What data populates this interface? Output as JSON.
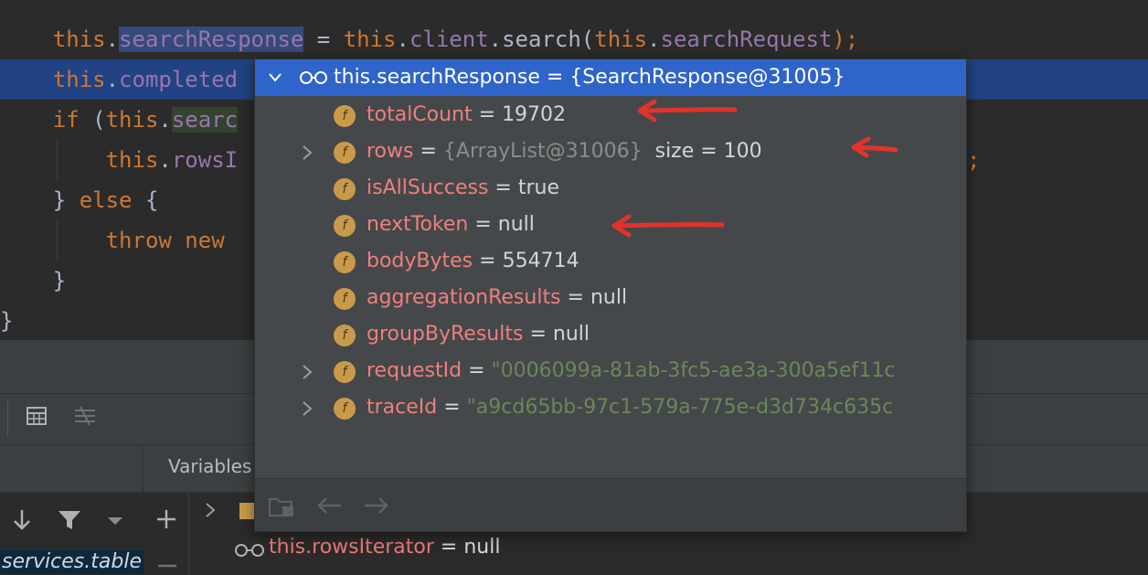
{
  "editor": {
    "line1": {
      "kw": "this",
      "dot": ".",
      "field": "searchResponse",
      "rest1": " = ",
      "kw2": "this",
      "dot2": ".",
      "field2": "client",
      "rest2": ".search(",
      "kw3": "this",
      "dot3": ".",
      "field3": "searchRequest",
      "rest3": ");"
    },
    "line2": {
      "kw": "this",
      "dot": ".",
      "field": "completed"
    },
    "line3": {
      "kw": "if",
      "rest": " (",
      "kw2": "this",
      "dot": ".",
      "field": "searc"
    },
    "line4": {
      "kw": "this",
      "dot": ".",
      "field": "rowsI",
      "tail": ";"
    },
    "line5": {
      "brace": "} ",
      "kw": "else",
      "rest": " {"
    },
    "line6": {
      "kw": "throw",
      "rest": " ",
      "kw2": "new"
    },
    "line7": {
      "brace": "}"
    },
    "line8": {
      "brace": "}"
    }
  },
  "popup": {
    "title": "this.searchResponse = {SearchResponse@31005}",
    "fields": [
      {
        "name": "totalCount",
        "eq": " = ",
        "value": "19702",
        "expandable": false
      },
      {
        "name": "rows",
        "eq": " = ",
        "ref": "{ArrayList@31006}",
        "size": "size = 100",
        "expandable": true
      },
      {
        "name": "isAllSuccess",
        "eq": " = ",
        "value": "true",
        "expandable": false
      },
      {
        "name": "nextToken",
        "eq": " = ",
        "value": "null",
        "expandable": false
      },
      {
        "name": "bodyBytes",
        "eq": " = ",
        "value": "554714",
        "expandable": false
      },
      {
        "name": "aggregationResults",
        "eq": " = ",
        "value": "null",
        "expandable": false
      },
      {
        "name": "groupByResults",
        "eq": " = ",
        "value": "null",
        "expandable": false
      },
      {
        "name": "requestId",
        "eq": " = ",
        "str": "\"0006099a-81ab-3fc5-ae3a-300a5ef11c",
        "expandable": true
      },
      {
        "name": "traceId",
        "eq": " = ",
        "str": "\"a9cd65bb-97c1-579a-775e-d3d734c635c",
        "expandable": true
      }
    ],
    "field_icon_letter": "f"
  },
  "debugger": {
    "variables_tab": "Variables",
    "services_label": "services.table",
    "watch": {
      "name": "this.rowsIterator",
      "eq": " = ",
      "value": "null"
    }
  },
  "colors": {
    "selection": "#214283",
    "header": "#2f65ca",
    "arrow": "#e0342a"
  }
}
